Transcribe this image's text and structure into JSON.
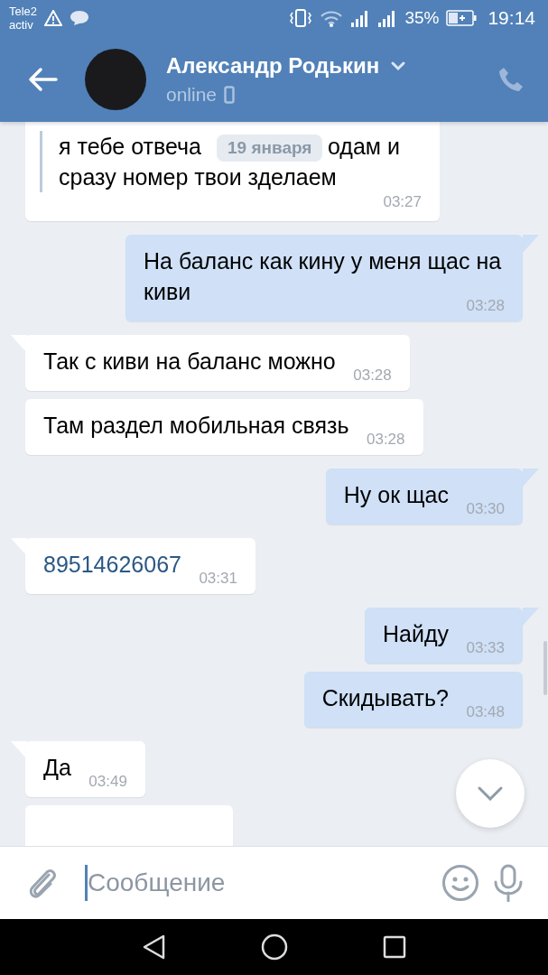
{
  "status_bar": {
    "carrier": [
      "Tele2",
      "activ"
    ],
    "battery": "35%",
    "time": "19:14"
  },
  "header": {
    "name": "Александр Родькин",
    "status": "online"
  },
  "date_badge": "19 января",
  "messages": [
    {
      "kind": "forwarded",
      "tail": false,
      "lines": [
        [
          "я тебе отвеча",
          "одам и"
        ],
        [
          "сразу номер твои зделаем"
        ]
      ],
      "time": "03:27"
    },
    {
      "kind": "out",
      "tail": true,
      "text": "На баланс как кину у меня щас на киви",
      "time": "03:28"
    },
    {
      "kind": "in",
      "tail": true,
      "text": "Так с киви на баланс можно",
      "time": "03:28"
    },
    {
      "kind": "in",
      "tail": false,
      "text": "Там раздел мобильная связь",
      "time": "03:28"
    },
    {
      "kind": "out",
      "tail": true,
      "text": "Ну ок щас",
      "time": "03:30"
    },
    {
      "kind": "in",
      "tail": true,
      "link": true,
      "text": "89514626067",
      "time": "03:31"
    },
    {
      "kind": "out",
      "tail": true,
      "text": "Найду",
      "time": "03:33"
    },
    {
      "kind": "out",
      "tail": false,
      "text": "Скидывать?",
      "time": "03:48"
    },
    {
      "kind": "in",
      "tail": true,
      "text": "Да",
      "time": "03:49"
    },
    {
      "kind": "in",
      "tail": false
    }
  ],
  "composer": {
    "placeholder": "Сообщение"
  }
}
